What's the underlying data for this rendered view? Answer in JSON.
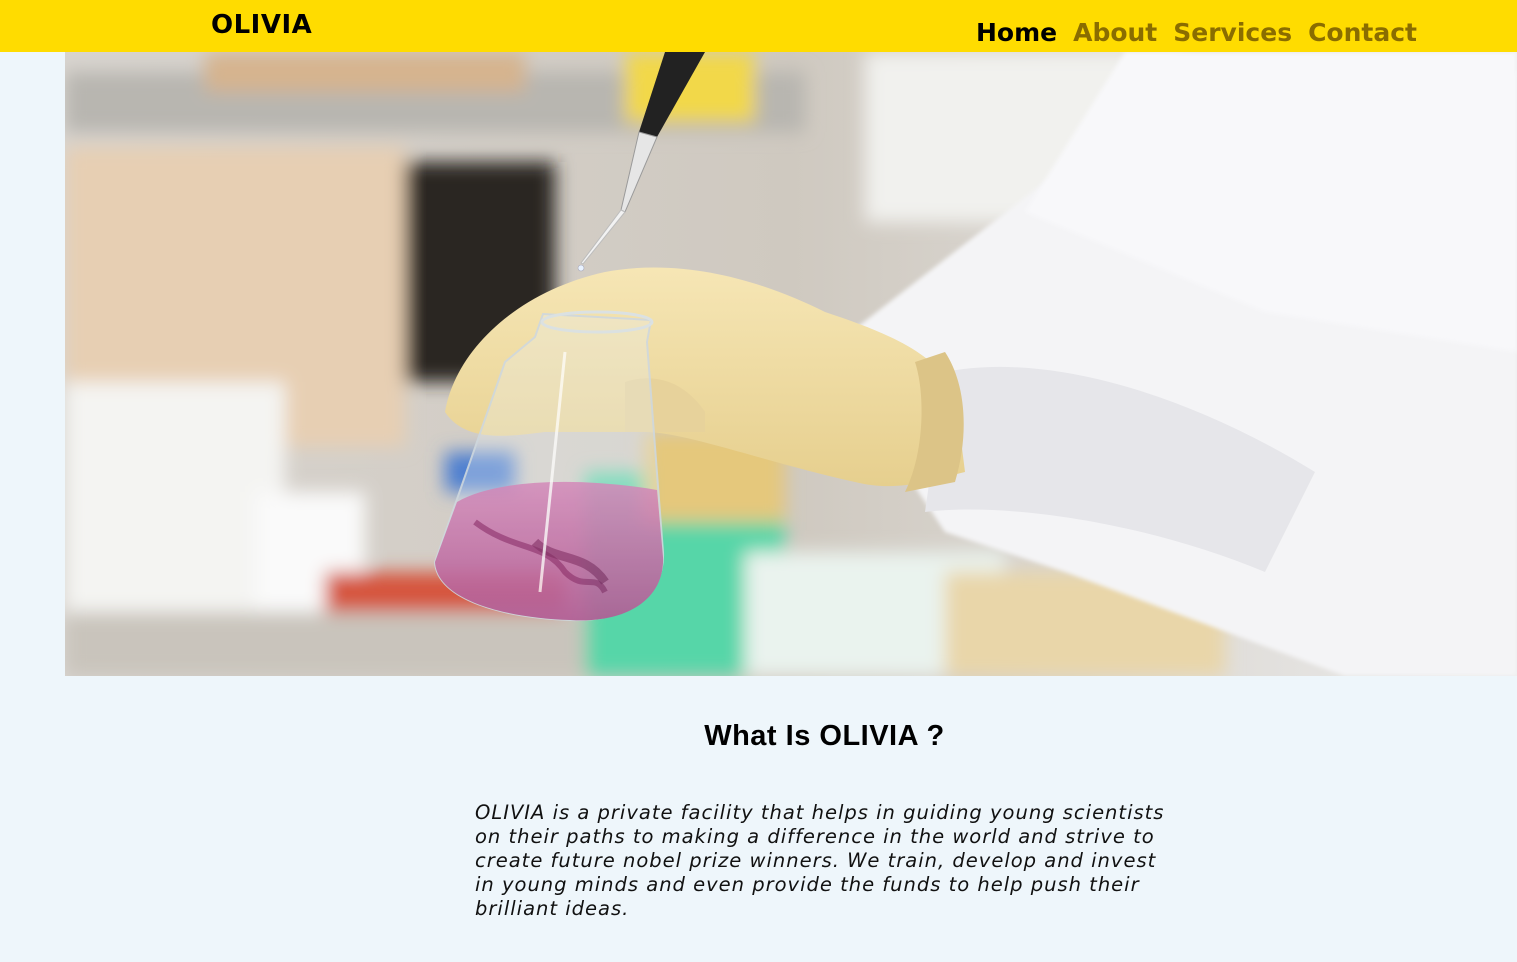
{
  "header": {
    "brand": "OLIVIA",
    "nav": [
      {
        "label": "Home",
        "active": true
      },
      {
        "label": "About",
        "active": false
      },
      {
        "label": "Services",
        "active": false
      },
      {
        "label": "Contact",
        "active": false
      }
    ],
    "background_color": "#ffdc00",
    "inactive_link_color": "#8a6d00"
  },
  "hero": {
    "image_subject": "laboratory-flask-photo"
  },
  "intro": {
    "heading": "What Is OLIVIA ?",
    "body": "OLIVIA is a private facility that helps in guiding young scientists on their paths to making a difference in the world and strive to create future nobel prize winners. We train, develop and invest in young minds and even provide the funds to help push their brilliant ideas."
  },
  "colors": {
    "page_background": "#eef6fb"
  }
}
